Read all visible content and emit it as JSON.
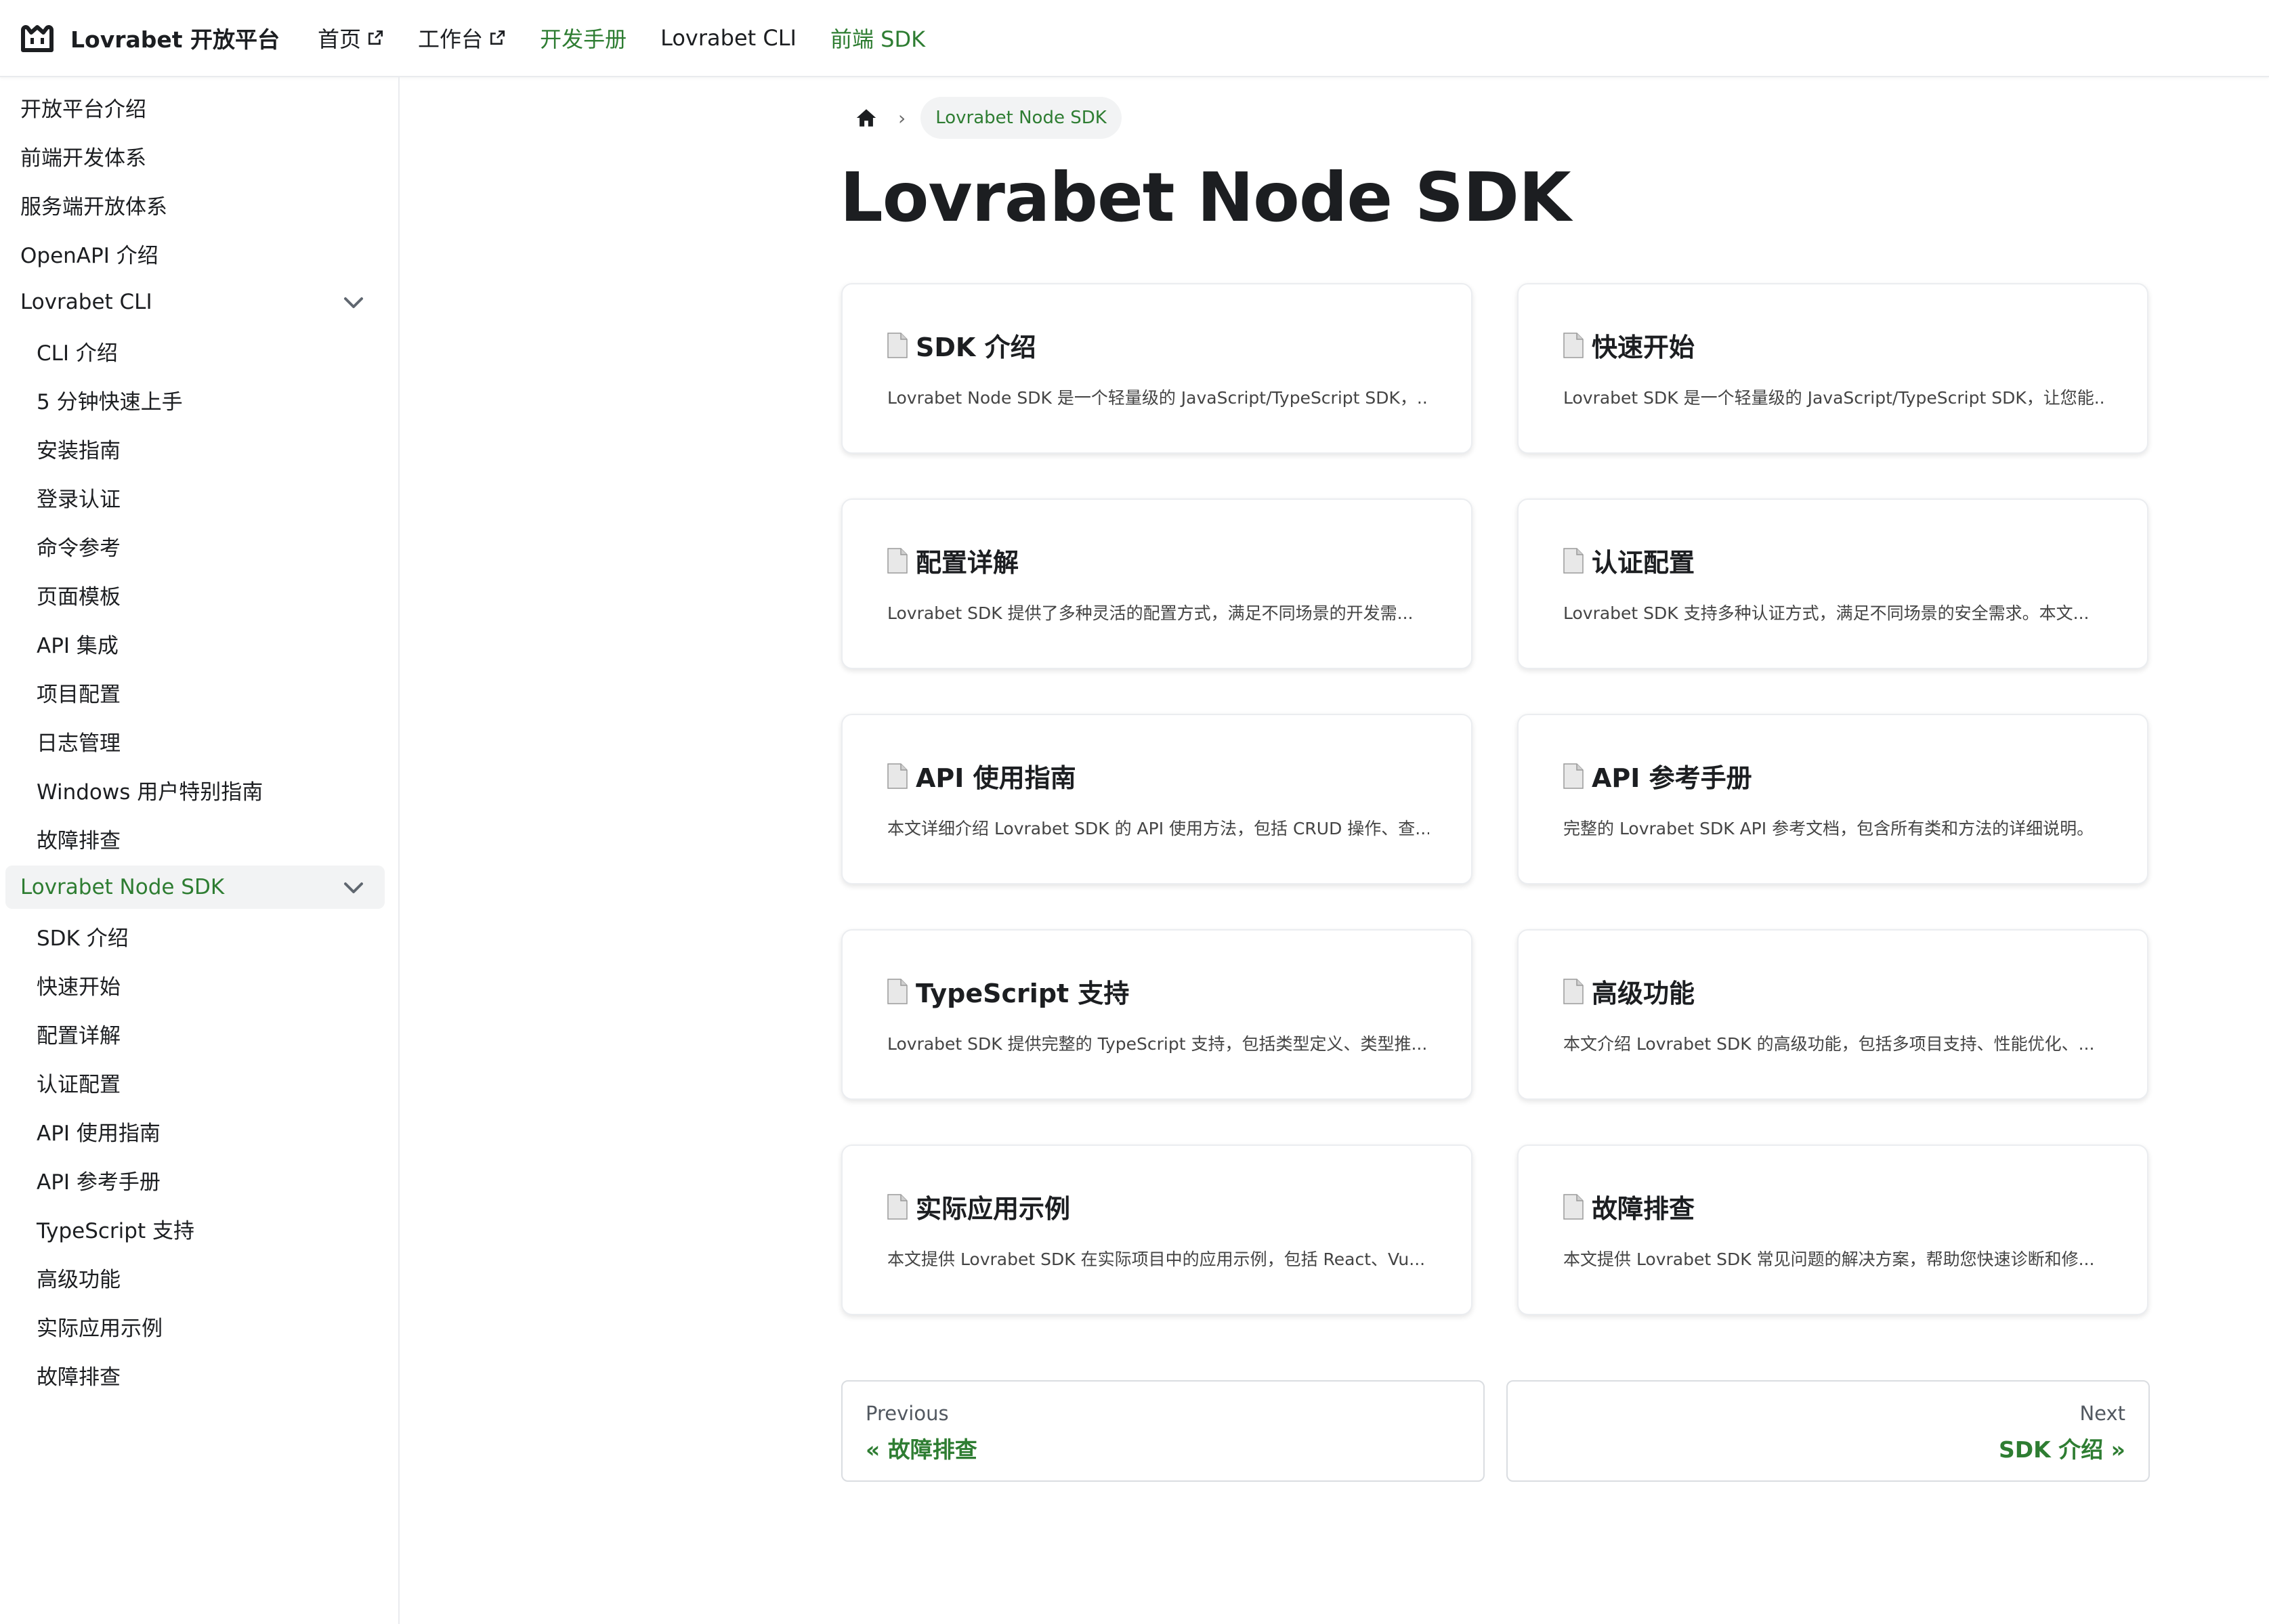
{
  "navbar": {
    "brand": "Lovrabet 开放平台",
    "items": [
      {
        "label": "首页",
        "external": true,
        "active": false
      },
      {
        "label": "工作台",
        "external": true,
        "active": false
      },
      {
        "label": "开发手册",
        "external": false,
        "active": true
      },
      {
        "label": "Lovrabet CLI",
        "external": false,
        "active": false
      },
      {
        "label": "前端 SDK",
        "external": false,
        "active": true
      }
    ]
  },
  "sidebar": {
    "items": [
      {
        "label": "开放平台介绍",
        "level": 0
      },
      {
        "label": "前端开发体系",
        "level": 0
      },
      {
        "label": "服务端开放体系",
        "level": 0
      },
      {
        "label": "OpenAPI 介绍",
        "level": 0
      },
      {
        "label": "Lovrabet CLI",
        "level": 0,
        "expanded": true
      },
      {
        "label": "CLI 介绍",
        "level": 1
      },
      {
        "label": "5 分钟快速上手",
        "level": 1
      },
      {
        "label": "安装指南",
        "level": 1
      },
      {
        "label": "登录认证",
        "level": 1
      },
      {
        "label": "命令参考",
        "level": 1
      },
      {
        "label": "页面模板",
        "level": 1
      },
      {
        "label": "API 集成",
        "level": 1
      },
      {
        "label": "项目配置",
        "level": 1
      },
      {
        "label": "日志管理",
        "level": 1
      },
      {
        "label": "Windows 用户特别指南",
        "level": 1
      },
      {
        "label": "故障排查",
        "level": 1
      },
      {
        "label": "Lovrabet Node SDK",
        "level": 0,
        "expanded": true,
        "active": true
      },
      {
        "label": "SDK 介绍",
        "level": 1
      },
      {
        "label": "快速开始",
        "level": 1
      },
      {
        "label": "配置详解",
        "level": 1
      },
      {
        "label": "认证配置",
        "level": 1
      },
      {
        "label": "API 使用指南",
        "level": 1
      },
      {
        "label": "API 参考手册",
        "level": 1
      },
      {
        "label": "TypeScript 支持",
        "level": 1
      },
      {
        "label": "高级功能",
        "level": 1
      },
      {
        "label": "实际应用示例",
        "level": 1
      },
      {
        "label": "故障排查",
        "level": 1
      }
    ]
  },
  "breadcrumb": {
    "current": "Lovrabet Node SDK"
  },
  "main": {
    "title": "Lovrabet Node SDK",
    "cards": [
      {
        "title": "SDK 介绍",
        "desc": "Lovrabet Node SDK 是一个轻量级的 JavaScript/TypeScript SDK，..."
      },
      {
        "title": "快速开始",
        "desc": "Lovrabet SDK 是一个轻量级的 JavaScript/TypeScript SDK，让您能..."
      },
      {
        "title": "配置详解",
        "desc": "Lovrabet SDK 提供了多种灵活的配置方式，满足不同场景的开发需..."
      },
      {
        "title": "认证配置",
        "desc": "Lovrabet SDK 支持多种认证方式，满足不同场景的安全需求。本文..."
      },
      {
        "title": "API 使用指南",
        "desc": "本文详细介绍 Lovrabet SDK 的 API 使用方法，包括 CRUD 操作、查..."
      },
      {
        "title": "API 参考手册",
        "desc": "完整的 Lovrabet SDK API 参考文档，包含所有类和方法的详细说明。"
      },
      {
        "title": "TypeScript 支持",
        "desc": "Lovrabet SDK 提供完整的 TypeScript 支持，包括类型定义、类型推..."
      },
      {
        "title": "高级功能",
        "desc": "本文介绍 Lovrabet SDK 的高级功能，包括多项目支持、性能优化、..."
      },
      {
        "title": "实际应用示例",
        "desc": "本文提供 Lovrabet SDK 在实际项目中的应用示例，包括 React、Vu..."
      },
      {
        "title": "故障排查",
        "desc": "本文提供 Lovrabet SDK 常见问题的解决方案，帮助您快速诊断和修..."
      }
    ]
  },
  "pagination": {
    "prev": {
      "sub": "Previous",
      "label": "« 故障排查"
    },
    "next": {
      "sub": "Next",
      "label": "SDK 介绍 »"
    }
  },
  "colors": {
    "accent": "#2e7d32",
    "text": "#1c1e21",
    "active_bg": "#f2f3f4"
  }
}
